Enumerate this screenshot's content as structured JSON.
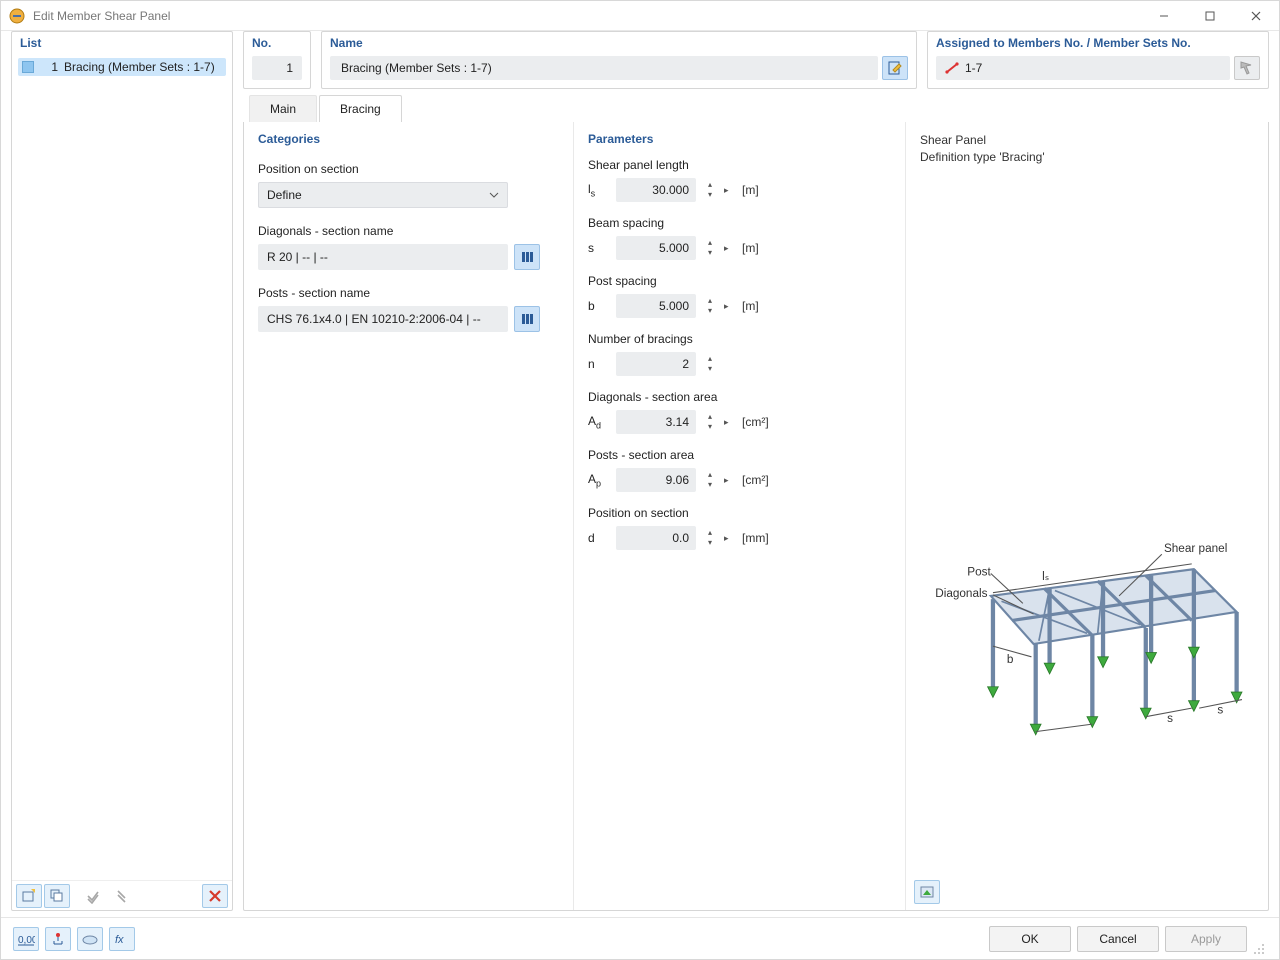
{
  "window": {
    "title": "Edit Member Shear Panel"
  },
  "headers": {
    "list": "List",
    "no": "No.",
    "name": "Name",
    "assigned": "Assigned to Members No. / Member Sets No."
  },
  "list": {
    "items": [
      {
        "index": "1",
        "label": "Bracing (Member Sets : 1-7)"
      }
    ]
  },
  "no_value": "1",
  "name_value": "Bracing (Member Sets : 1-7)",
  "assigned_value": "1-7",
  "tabs": {
    "main": "Main",
    "bracing": "Bracing"
  },
  "categories": {
    "title": "Categories",
    "pos_label": "Position on section",
    "pos_value": "Define",
    "diag_label": "Diagonals - section name",
    "diag_value": "R 20 | -- | --",
    "post_label": "Posts - section name",
    "post_value": "CHS 76.1x4.0 | EN 10210-2:2006-04 | --"
  },
  "parameters": {
    "title": "Parameters",
    "rows": {
      "ls": {
        "label": "Shear panel length",
        "sym": "l",
        "sub": "s",
        "value": "30.000",
        "unit": "[m]",
        "has_flyout": true
      },
      "s": {
        "label": "Beam spacing",
        "sym": "s",
        "sub": "",
        "value": "5.000",
        "unit": "[m]",
        "has_flyout": true
      },
      "b": {
        "label": "Post spacing",
        "sym": "b",
        "sub": "",
        "value": "5.000",
        "unit": "[m]",
        "has_flyout": true
      },
      "n": {
        "label": "Number of bracings",
        "sym": "n",
        "sub": "",
        "value": "2",
        "unit": "",
        "has_flyout": false
      },
      "ad": {
        "label": "Diagonals - section area",
        "sym": "A",
        "sub": "d",
        "value": "3.14",
        "unit": "[cm²]",
        "has_flyout": true
      },
      "ap": {
        "label": "Posts - section area",
        "sym": "A",
        "sub": "p",
        "value": "9.06",
        "unit": "[cm²]",
        "has_flyout": true
      },
      "d": {
        "label": "Position on section",
        "sym": "d",
        "sub": "",
        "value": "0.0",
        "unit": "[mm]",
        "has_flyout": true
      }
    }
  },
  "info": {
    "line1": "Shear Panel",
    "line2": "Definition type 'Bracing'",
    "labels": {
      "shear_panel": "Shear panel",
      "post": "Post",
      "diagonals": "Diagonals",
      "ls": "lₛ",
      "s": "s",
      "b": "b"
    }
  },
  "footer": {
    "ok": "OK",
    "cancel": "Cancel",
    "apply": "Apply"
  },
  "colors": {
    "accent": "#2b5b97",
    "field_bg": "#ebedef",
    "highlight": "#cde3f8",
    "steel": "#8fa7c2",
    "support": "#3eaa3e"
  }
}
